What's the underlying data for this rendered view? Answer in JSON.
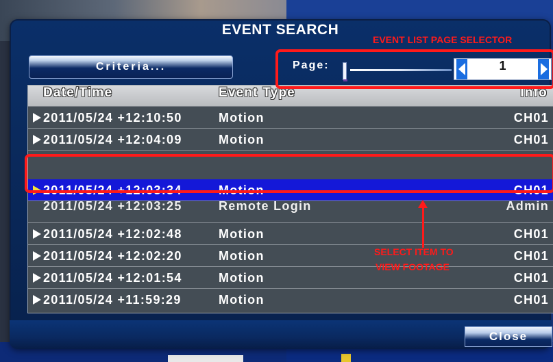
{
  "dialog": {
    "title": "EVENT SEARCH",
    "criteria_label": "Criteria...",
    "page_label": "Page:",
    "page_value": "1",
    "close_label": "Close"
  },
  "table": {
    "headers": [
      "Date/Time",
      "Event Type",
      "Info"
    ],
    "rows": [
      {
        "datetime": "2011/05/24 +12:10:50",
        "type": "Motion",
        "info": "CH01"
      },
      {
        "datetime": "2011/05/24 +12:04:09",
        "type": "Motion",
        "info": "CH01"
      },
      {
        "datetime": "2011/05/24 +12:03:34",
        "type": "Motion",
        "info": "CH01"
      },
      {
        "datetime": "2011/05/24 +12:03:25",
        "type": "Remote Login",
        "info": "Admin"
      },
      {
        "datetime": "2011/05/24 +12:02:48",
        "type": "Motion",
        "info": "CH01"
      },
      {
        "datetime": "2011/05/24 +12:02:20",
        "type": "Motion",
        "info": "CH01"
      },
      {
        "datetime": "2011/05/24 +12:01:54",
        "type": "Motion",
        "info": "CH01"
      },
      {
        "datetime": "2011/05/24 +11:59:29",
        "type": "Motion",
        "info": "CH01"
      }
    ],
    "selected_index": 2
  },
  "annotations": {
    "page_selector": "EVENT LIST PAGE SELECTOR",
    "select_line1": "SELECT ITEM TO",
    "select_line2": "VIEW FOOTAGE"
  },
  "colors": {
    "selection": "#1418d8",
    "annotation": "#ff1a1a",
    "dialog": "#0a2b5f"
  }
}
